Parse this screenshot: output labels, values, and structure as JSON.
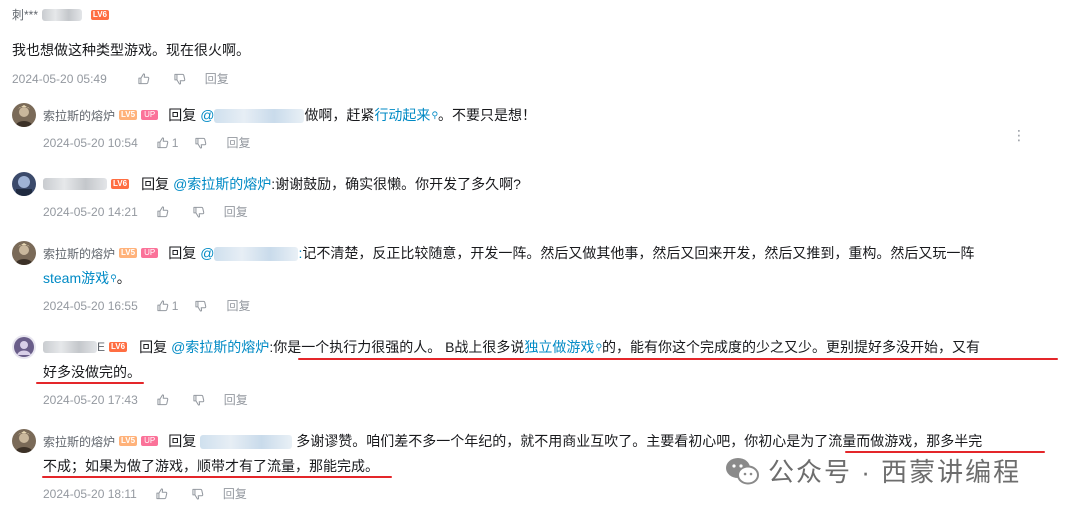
{
  "top_comment": {
    "username": "刺***",
    "level": "LV6",
    "text": "我也想做这种类型游戏。现在很火啊。",
    "timestamp": "2024-05-20 05:49",
    "reply_label": "回复"
  },
  "replies": [
    {
      "username": "索拉斯的熔炉",
      "level": "LV5",
      "up_badge": "UP",
      "reply_word": "回复",
      "segments": [
        {
          "t": "做啊，赶紧",
          "k": "text"
        },
        {
          "t": "行动起来",
          "k": "link"
        },
        {
          "t": "。不要只是想！",
          "k": "text"
        }
      ],
      "timestamp": "2024-05-20 10:54",
      "like_count": "1",
      "reply_label": "回复"
    },
    {
      "username": "",
      "level": "LV6",
      "reply_word": "回复",
      "mention": "@索拉斯的熔炉",
      "segments": [
        {
          "t": ":谢谢鼓励，确实很懒。你开发了多久啊?",
          "k": "text"
        }
      ],
      "timestamp": "2024-05-20 14:21",
      "reply_label": "回复"
    },
    {
      "username": "索拉斯的熔炉",
      "level": "LV5",
      "up_badge": "UP",
      "reply_word": "回复",
      "line1": "记不清楚，反正比较随意，开发一阵。然后又做其他事，然后又回来开发，然后又推到，重构。然后又玩一阵",
      "line2_link": "steam游戏",
      "line2_tail": "。",
      "timestamp": "2024-05-20 16:55",
      "like_count": "1",
      "reply_label": "回复"
    },
    {
      "username": "E",
      "level": "LV6",
      "reply_word": "回复",
      "mention": "@索拉斯的熔炉",
      "line1_a": ":你是一个执行力很强的人。 B战上很多说",
      "line1_link": "独立做游戏",
      "line1_b": "的，能有你这个完成度的少之又少。更别提好多没开始，又有",
      "line2": "好多没做完的。",
      "timestamp": "2024-05-20 17:43",
      "reply_label": "回复"
    },
    {
      "username": "索拉斯的熔炉",
      "level": "LV5",
      "up_badge": "UP",
      "reply_word": "回复",
      "line1": "多谢谬赞。咱们差不多一个年纪的，就不用商业互吹了。主要看初心吧，你初心是为了流量而做游戏，那多半完",
      "line2": "不成；如果为做了游戏，顺带才有了流量，那能完成。",
      "timestamp": "2024-05-20 18:11",
      "reply_label": "回复"
    }
  ],
  "more_icon": "more-vertical-icon",
  "watermark": "公众号 · 西蒙讲编程",
  "colors": {
    "link": "#008ac5",
    "underline": "#e4262a",
    "meta": "#9499a0",
    "up": "#fb7299",
    "lv6": "#ff6e42",
    "lv5": "#ffb27a"
  }
}
